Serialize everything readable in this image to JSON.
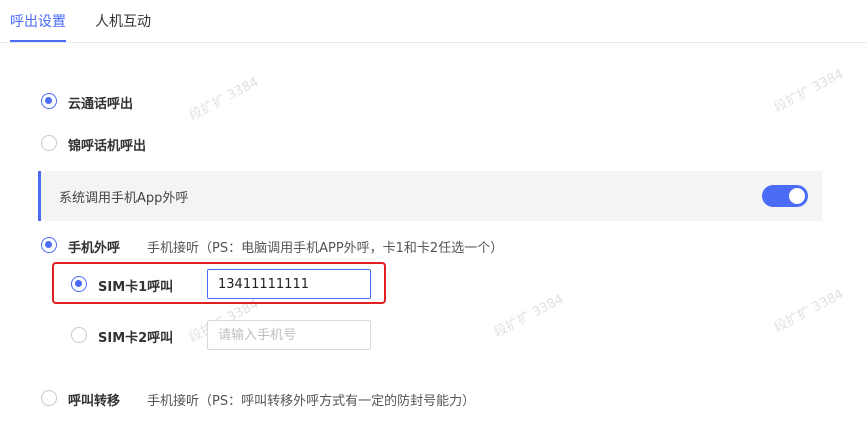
{
  "tabs": [
    {
      "label": "呼出设置",
      "active": true
    },
    {
      "label": "人机互动",
      "active": false
    }
  ],
  "watermark": "段扩扩 3384",
  "options": {
    "cloud_call": {
      "label": "云通话呼出",
      "checked": true
    },
    "jin_phone": {
      "label": "锦呼话机呼出",
      "checked": false
    }
  },
  "app_banner": {
    "text": "系统调用手机App外呼",
    "toggle_on": true
  },
  "mobile_call": {
    "label": "手机外呼",
    "desc": "手机接听（PS：电脑调用手机APP外呼，卡1和卡2任选一个）",
    "checked": true,
    "sim1": {
      "label": "SIM卡1呼叫",
      "value": "13411111111",
      "checked": true
    },
    "sim2": {
      "label": "SIM卡2呼叫",
      "placeholder": "请输入手机号",
      "checked": false
    }
  },
  "transfer": {
    "label": "呼叫转移",
    "desc": "手机接听（PS：呼叫转移外呼方式有一定的防封号能力）",
    "checked": false
  },
  "colors": {
    "accent": "#4a6cf7",
    "highlight": "#e02020"
  }
}
